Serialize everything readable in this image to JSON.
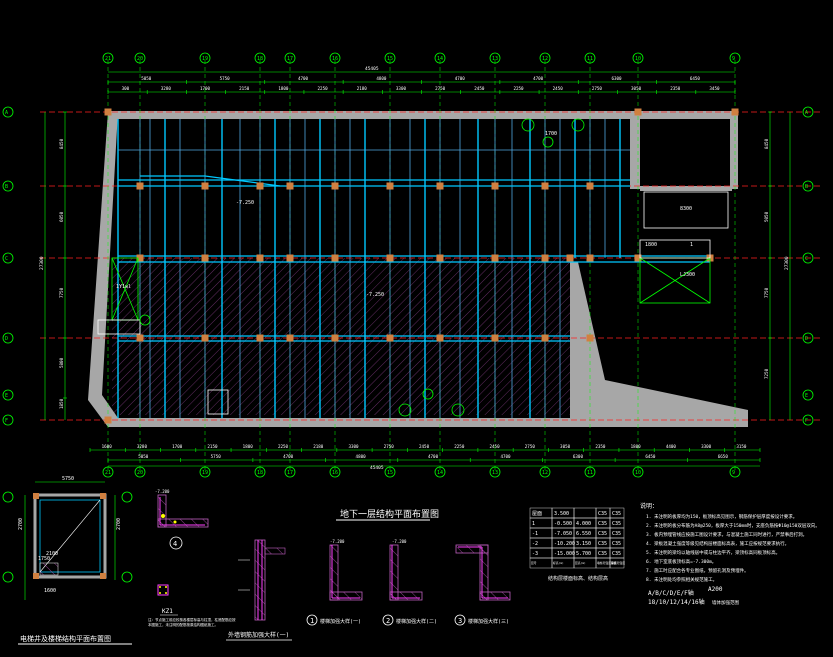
{
  "drawing": {
    "colors": {
      "background": "#000000",
      "wall": "#a7a7a7",
      "wall_dark": "#808080",
      "axis_dim": "#00ff00",
      "beam": "#00c8ff",
      "beam_light": "#7fd8ff",
      "axis_red": "#ff2020",
      "hatch": "#c060c0",
      "column": "#d08040",
      "text": "#ffffff",
      "label_yellow": "#ffff00",
      "magenta": "#ff40ff"
    },
    "top_axes": [
      "21",
      "20",
      "19",
      "18",
      "17",
      "16",
      "15",
      "14",
      "13",
      "12",
      "11",
      "10",
      "9"
    ],
    "bottom_axes": [
      "21",
      "20",
      "19",
      "18",
      "17",
      "16",
      "15",
      "14",
      "13",
      "12",
      "11",
      "10",
      "9"
    ],
    "left_axes": [
      "A",
      "B",
      "C",
      "D",
      "E",
      "F"
    ],
    "right_axes": [
      "A",
      "B",
      "C",
      "D",
      "E",
      "F"
    ],
    "top_total_dim": "45405",
    "bottom_total_dim": "45405",
    "top_dim_row1": [
      "5050",
      "5750",
      "4700",
      "4800",
      "4700",
      "4700",
      "6300",
      "6450"
    ],
    "top_dim_row2": [
      "300",
      "3280",
      "1700",
      "2150",
      "1800",
      "2250",
      "2180",
      "3300",
      "2750",
      "2450",
      "2250",
      "2450",
      "2750",
      "3050",
      "2350",
      "3450"
    ],
    "bottom_dim_row1": [
      "1600",
      "3280",
      "1700",
      "2150",
      "1800",
      "2250",
      "2180",
      "3300",
      "2750",
      "2450",
      "2250",
      "2450",
      "2750",
      "3050",
      "2350",
      "1800",
      "4400",
      "3300",
      "3150"
    ],
    "bottom_dim_row2": [
      "5050",
      "5750",
      "4700",
      "4800",
      "4700",
      "4700",
      "6300",
      "6450",
      "6650"
    ],
    "left_dims": [
      "8450",
      "6050",
      "7750",
      "5800",
      "1850"
    ],
    "left_total": "27300",
    "right_dims": [
      "8450",
      "5050",
      "7750",
      "7250"
    ],
    "right_total": "27300",
    "inner_labels": [
      "-7.250",
      "-7.250",
      "1700",
      "1800",
      "1",
      "LJ300",
      "8300",
      "1Y1wl"
    ],
    "plan_title": "地下一层结构平面布置图",
    "left_plan_title": "电梯井及楼梯结构平面布置图",
    "left_plan_dims": [
      "5750",
      "1750",
      "2100",
      "1600",
      "2700",
      "2700"
    ],
    "detail_labels": {
      "d4": "4",
      "kz1": "KZ1",
      "kz1_note": "注：节点施工前应校核各楼层标高与柱顶，柱底配筋应按本图施工，未注明的配筋按原结构图纸施工。",
      "wall_detail": "外墙钢筋加强大样(一)",
      "d1": "1",
      "d1_title": "楼梯加强大样(一)",
      "d2": "2",
      "d2_title": "楼梯加强大样(二)",
      "d3": "3",
      "d3_title": "楼梯加强大样(三)",
      "elev": "-7.200"
    },
    "table": {
      "rows": [
        [
          "屋面",
          "3.500",
          "",
          "C35",
          "C35"
        ],
        [
          "1",
          "-0.500",
          "4.000",
          "C35",
          "C35"
        ],
        [
          "-1",
          "-7.050",
          "6.550",
          "C35",
          "C35"
        ],
        [
          "-2",
          "-10.200",
          "3.150",
          "C35",
          "C35"
        ],
        [
          "-3",
          "-15.000",
          "5.700",
          "C35",
          "C35"
        ]
      ],
      "footer": [
        "层号",
        "标高(m)",
        "层高(m)",
        "墙柱砼强度等级",
        "梁板砼强度"
      ],
      "caption": "结构层楼面标高、结构层高"
    },
    "notes": {
      "title": "说明：",
      "items": [
        "1. 未注明的板厚均为150，板顶标高见图示，钢筋保护层厚度按设计要求。",
        "2. 未注明的板分布筋为A8@250，板厚大于150mm时，支座负筋按Φ10@150双层双向。",
        "3. 板内预埋管线应按施工图设计要求，与混凝土施工同时进行，严禁事后打洞。",
        "4. 梁板混凝土强度等级见结构层楼面标高表，施工应按规范要求执行。",
        "5. 未注明的梁均以轴线居中或与柱边平齐，梁顶标高同板顶标高。",
        "6. 地下室底板顶标高=-7.300m。",
        "7. 施工时应配合各专业图纸，预留孔洞及预埋件。",
        "8. 未注明处均参照相关规范施工。"
      ],
      "axis_note": "A/B/C/D/E/F轴",
      "axis_note2": "A200",
      "axis_list": "18/10/12/14/16轴",
      "axis_suffix": "墙体加强范围"
    }
  }
}
